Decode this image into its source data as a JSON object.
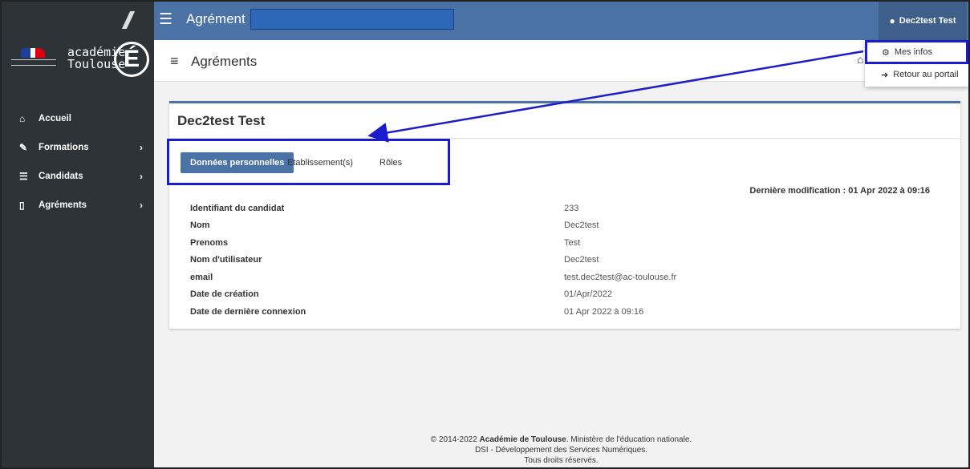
{
  "sidebar": {
    "logo": {
      "acad_line1": "académie",
      "acad_line2": "Toulouse",
      "letter": "É"
    },
    "items": [
      {
        "label": "Accueil",
        "icon": "home-icon",
        "chevron": false
      },
      {
        "label": "Formations",
        "icon": "edit-icon",
        "chevron": true
      },
      {
        "label": "Candidats",
        "icon": "list-icon",
        "chevron": true
      },
      {
        "label": "Agréments",
        "icon": "file-icon",
        "chevron": true
      }
    ]
  },
  "topbar": {
    "title": "Agrément",
    "user": "Dec2test Test"
  },
  "pagehead": {
    "title": "Agréments"
  },
  "dropdown": {
    "items": [
      {
        "label": "Mes infos",
        "icon": "gear-icon"
      },
      {
        "label": "Retour au portail",
        "icon": "sign-out-icon"
      }
    ]
  },
  "card": {
    "title": "Dec2test Test",
    "tabs": [
      "Données personnelles",
      "Etablissement(s)",
      "Rôles"
    ],
    "last_modified": "Dernière modification : 01 Apr 2022 à 09:16",
    "rows": [
      {
        "k": "Identifiant du candidat",
        "v": "233"
      },
      {
        "k": "Nom",
        "v": "Dec2test"
      },
      {
        "k": "Prenoms",
        "v": "Test"
      },
      {
        "k": "Nom d'utilisateur",
        "v": "Dec2test"
      },
      {
        "k": "email",
        "v": "test.dec2test@ac-toulouse.fr"
      },
      {
        "k": "Date de création",
        "v": "01/Apr/2022"
      },
      {
        "k": "Date de dernière connexion",
        "v": "01 Apr 2022 à 09:16"
      }
    ]
  },
  "footer": {
    "line1_a": "© 2014-2022 ",
    "line1_b": "Académie de Toulouse",
    "line1_c": ". Ministère de l'éducation nationale.",
    "line2": "DSI - Développement des Services Numériques.",
    "line3": "Tous droits réservés."
  },
  "colors": {
    "brand": "#4b72a4",
    "sidebar": "#2e3337",
    "annotation": "#1c1ccf"
  }
}
